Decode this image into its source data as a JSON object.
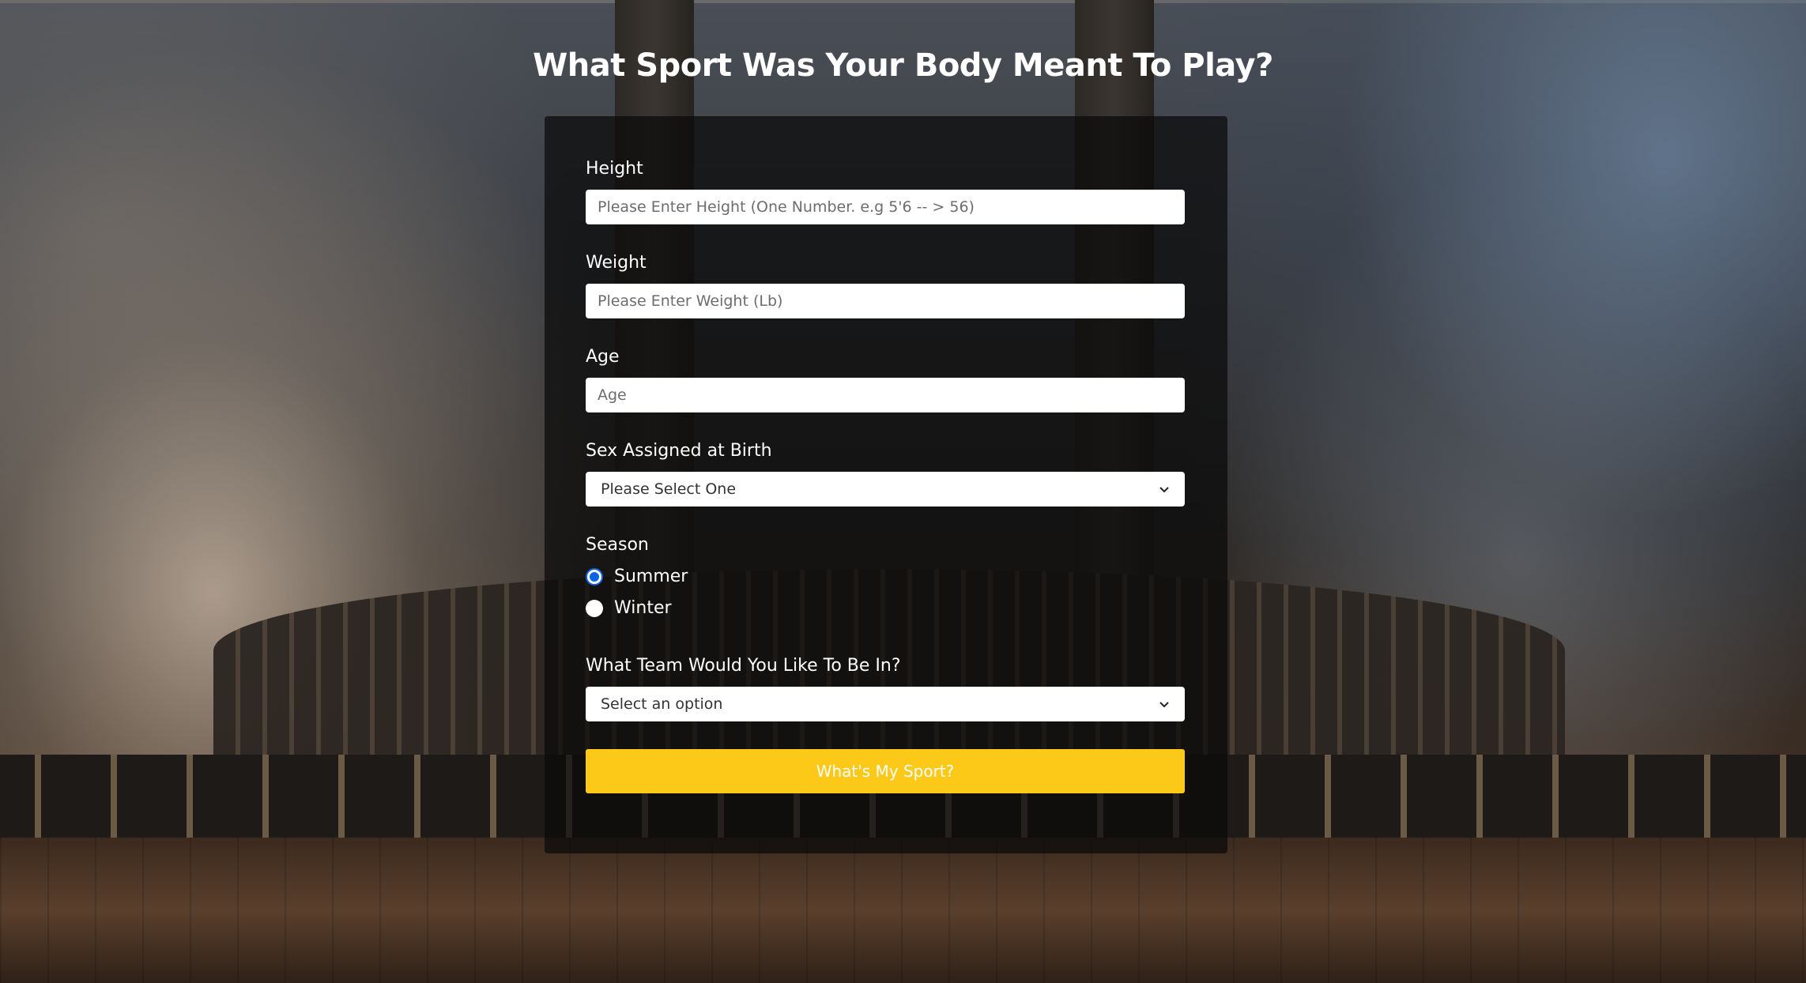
{
  "page": {
    "title": "What Sport Was Your Body Meant To Play?"
  },
  "form": {
    "height": {
      "label": "Height",
      "placeholder": "Please Enter Height (One Number. e.g 5'6 -- > 56)",
      "value": ""
    },
    "weight": {
      "label": "Weight",
      "placeholder": "Please Enter Weight (Lb)",
      "value": ""
    },
    "age": {
      "label": "Age",
      "placeholder": "Age",
      "value": ""
    },
    "sex": {
      "label": "Sex Assigned at Birth",
      "selected": "Please Select One"
    },
    "season": {
      "label": "Season",
      "options": [
        {
          "label": "Summer",
          "checked": true
        },
        {
          "label": "Winter",
          "checked": false
        }
      ]
    },
    "team": {
      "label": "What Team Would You Like To Be In?",
      "selected": "Select an option"
    },
    "submit_label": "What's My Sport?"
  },
  "colors": {
    "accent": "#fcc918",
    "radio_selected": "#0b63e5",
    "card_background": "rgba(10,10,10,0.72)"
  },
  "icons": {
    "select_arrow": "chevron-down-icon"
  }
}
